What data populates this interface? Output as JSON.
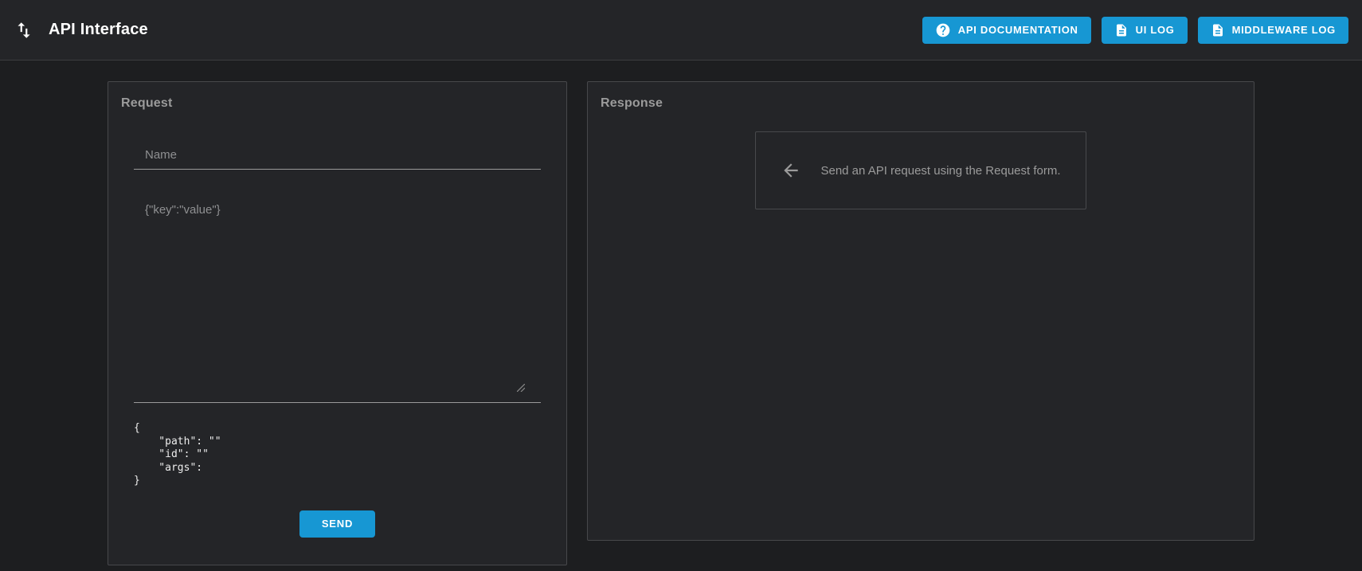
{
  "header": {
    "title": "API Interface",
    "logo_icon": "swap-vertical-arrows-icon",
    "buttons": [
      {
        "label": "API DOCUMENTATION",
        "icon": "help-circle-icon"
      },
      {
        "label": "UI LOG",
        "icon": "file-document-icon"
      },
      {
        "label": "MIDDLEWARE LOG",
        "icon": "file-document-icon"
      }
    ]
  },
  "request_panel": {
    "title": "Request",
    "name_field": {
      "value": "",
      "placeholder": "Name"
    },
    "body_field": {
      "value": "",
      "placeholder": "{\"key\":\"value\"}"
    },
    "request_preview": "{\n    \"path\": \"\"\n    \"id\": \"\"\n    \"args\": \n}",
    "send_button_label": "SEND"
  },
  "response_panel": {
    "title": "Response",
    "empty_state": {
      "icon": "arrow-left-icon",
      "message": "Send an API request using the Request form."
    }
  },
  "colors": {
    "accent_blue": "#1797d3",
    "page_background": "#1d1e20",
    "panel_background": "#242528",
    "panel_border": "#47484b",
    "muted_text": "#9b9b9b",
    "underline": "#9a9a9a"
  }
}
